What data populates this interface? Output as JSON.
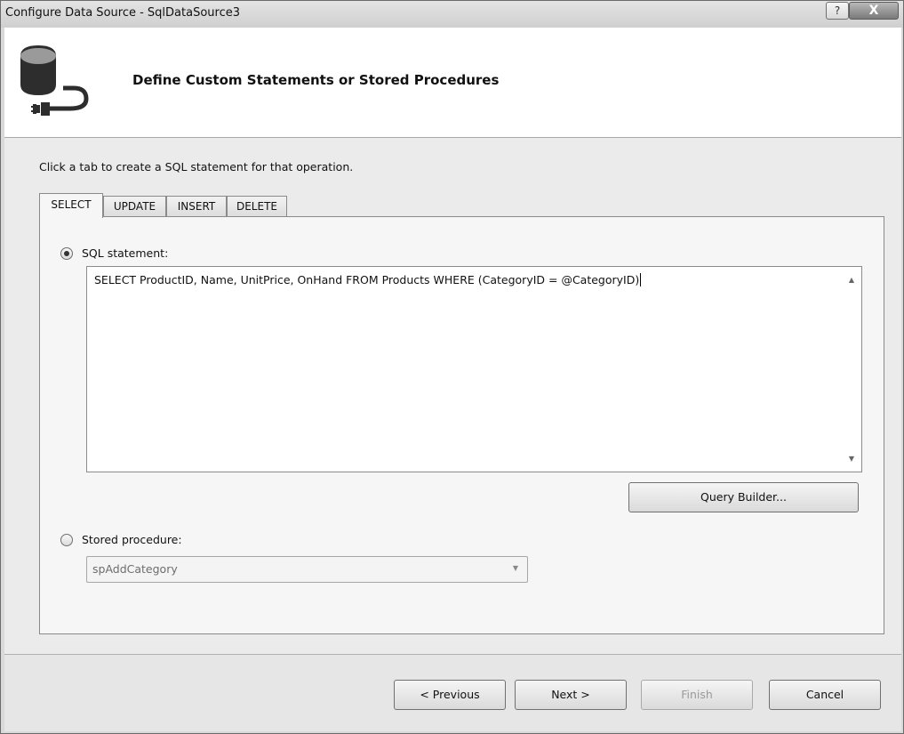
{
  "window": {
    "title": "Configure Data Source - SqlDataSource3",
    "help_label": "?",
    "close_label": "X"
  },
  "header": {
    "title": "Define Custom Statements or Stored Procedures",
    "icon": "database-plug-icon"
  },
  "instruction": "Click a tab to create a SQL statement for that operation.",
  "tabs": [
    {
      "label": "SELECT",
      "active": true
    },
    {
      "label": "UPDATE",
      "active": false
    },
    {
      "label": "INSERT",
      "active": false
    },
    {
      "label": "DELETE",
      "active": false
    }
  ],
  "sql_option": {
    "label": "SQL statement:",
    "selected": true,
    "value": "SELECT ProductID, Name, UnitPrice, OnHand FROM Products WHERE (CategoryID = @CategoryID)"
  },
  "query_builder_label": "Query Builder...",
  "stored_procedure_option": {
    "label": "Stored procedure:",
    "selected": false,
    "value": "spAddCategory"
  },
  "footer": {
    "previous_label": "< Previous",
    "next_label": "Next >",
    "finish_label": "Finish",
    "cancel_label": "Cancel"
  }
}
